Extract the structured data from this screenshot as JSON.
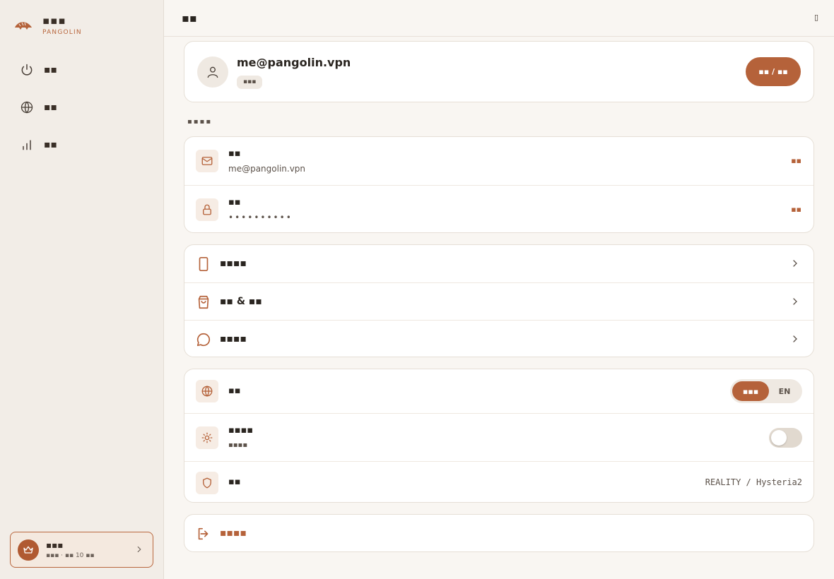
{
  "brand": {
    "name": "▪▪▪",
    "subtitle": "PANGOLIN"
  },
  "sidebar": {
    "items": [
      {
        "label": "▪▪",
        "icon": "power-icon"
      },
      {
        "label": "▪▪",
        "icon": "globe-icon"
      },
      {
        "label": "▪▪",
        "icon": "bar-chart-icon"
      }
    ]
  },
  "plan": {
    "title": "▪▪▪",
    "subtitle": "▪▪▪ · ▪▪ 10 ▪▪",
    "icon": "crown-icon"
  },
  "header": {
    "title": "▪▪",
    "mark": "▯"
  },
  "profile": {
    "email": "me@pangolin.vpn",
    "badge": "▪▪▪",
    "button_label": "▪▪ / ▪▪"
  },
  "account_section": {
    "label": "▪▪▪▪"
  },
  "account": {
    "email": {
      "title": "▪▪",
      "value": "me@pangolin.vpn",
      "action": "▪▪"
    },
    "password": {
      "title": "▪▪",
      "value": "••••••••••",
      "action": "▪▪"
    }
  },
  "menu": [
    {
      "label": "▪▪▪▪",
      "icon": "phone-icon"
    },
    {
      "label": "▪▪ & ▪▪",
      "icon": "shopping-bag-icon"
    },
    {
      "label": "▪▪▪▪",
      "icon": "chat-icon"
    }
  ],
  "preferences": {
    "language": {
      "title": "▪▪",
      "options": [
        "▪▪▪",
        "EN"
      ],
      "selected": "▪▪▪"
    },
    "theme": {
      "title": "▪▪▪▪",
      "subtitle": "▪▪▪▪",
      "enabled": false
    },
    "protocol": {
      "title": "▪▪",
      "value": "REALITY / Hysteria2"
    }
  },
  "logout": {
    "label": "▪▪▪▪"
  },
  "colors": {
    "accent": "#b5623a",
    "sidebar_bg": "#f2ede7",
    "page_bg": "#f9f6f2",
    "card_bg": "#ffffff"
  }
}
